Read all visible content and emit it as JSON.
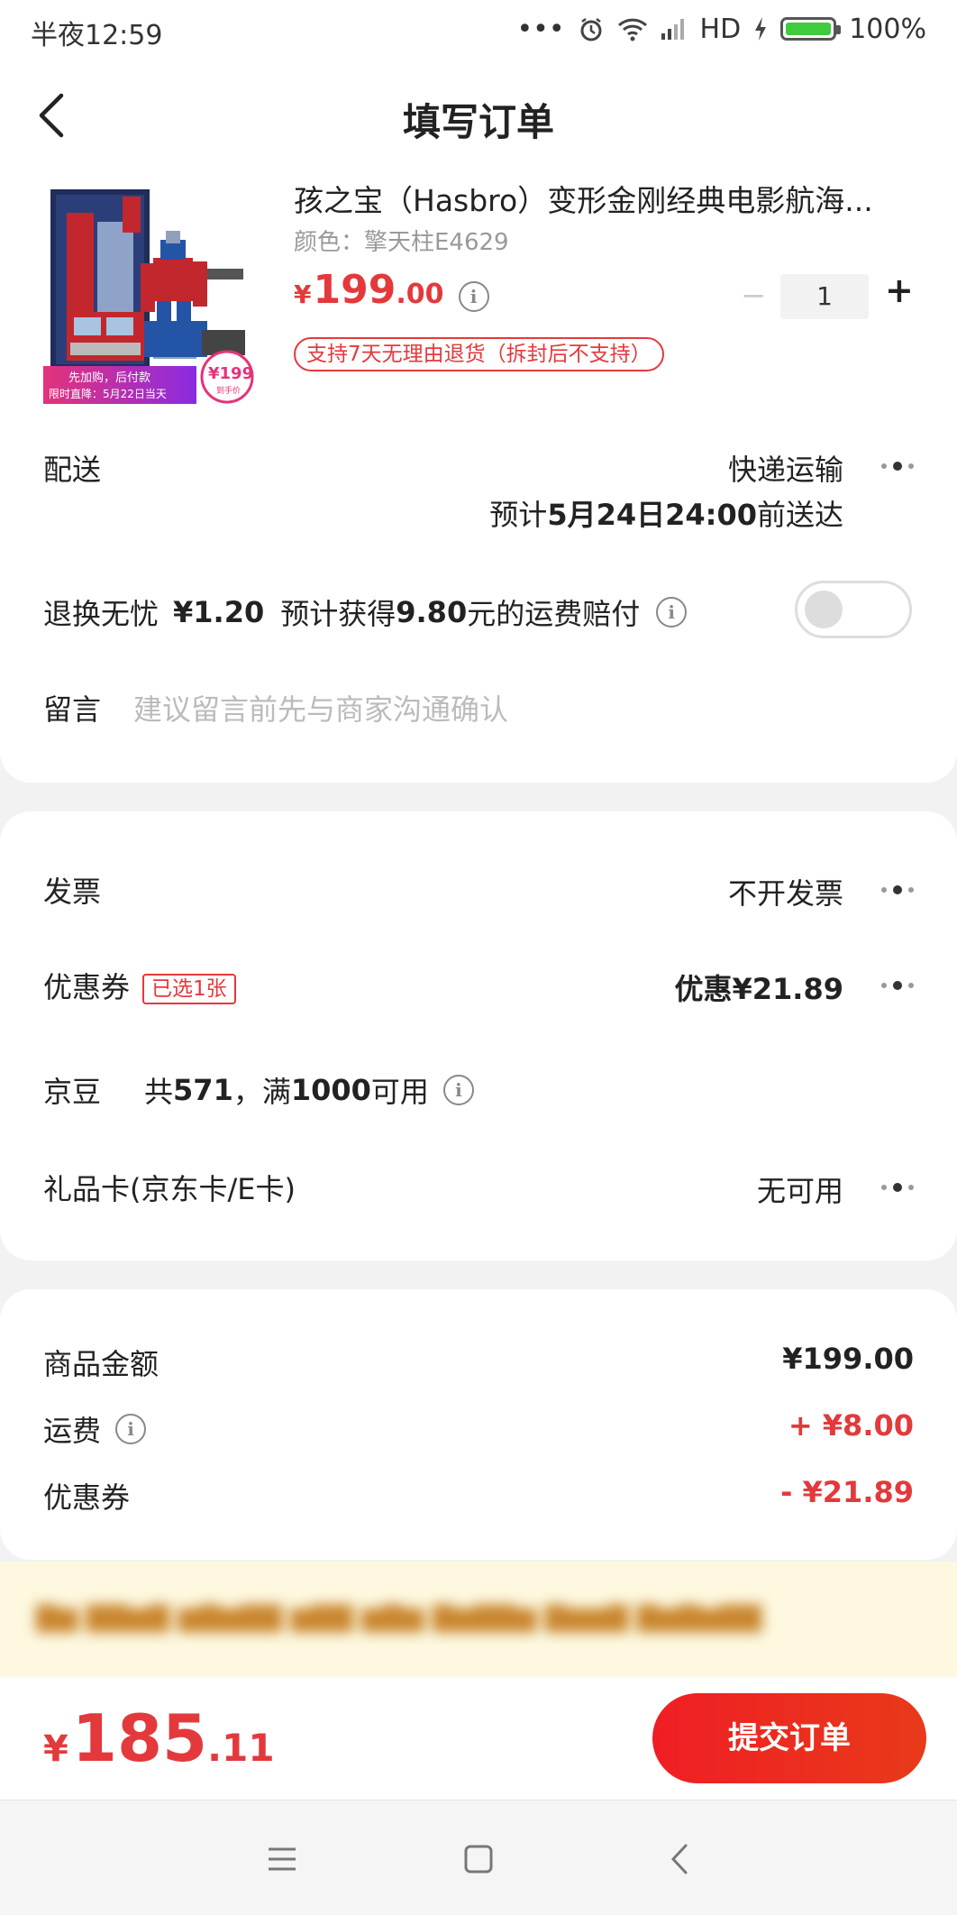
{
  "status_bar": {
    "time": "半夜12:59",
    "signal": "HD",
    "battery": "100%",
    "battery_level": 1.0
  },
  "header": {
    "title": "填写订单",
    "back_icon": "chevron-left-icon"
  },
  "product": {
    "title": "孩之宝（Hasbro）变形金刚经典电影航海...",
    "variant": "颜色：擎天柱E4629",
    "price_symbol": "¥",
    "price_int": "199",
    "price_dec": ".00",
    "quantity": "1",
    "return_tag": "支持7天无理由退货（拆封后不支持）",
    "image_banner_line1": "先加购，后付款",
    "image_banner_line2": "限时直降：5月22日当天",
    "image_price_badge": "¥199",
    "image_price_badge_note": "到手价"
  },
  "delivery": {
    "label": "配送",
    "method": "快递运输",
    "estimate_prefix": "预计",
    "estimate_date": "5月24日24:00",
    "estimate_suffix": "前送达"
  },
  "return_insurance": {
    "label": "退换无忧",
    "price": "¥1.20",
    "desc_prefix": "预计获得",
    "amount": "9.80",
    "desc_suffix": "元的运费赔付",
    "enabled": false
  },
  "message": {
    "label": "留言",
    "placeholder": "建议留言前先与商家沟通确认",
    "value": ""
  },
  "invoice": {
    "label": "发票",
    "value": "不开发票"
  },
  "coupon": {
    "label": "优惠券",
    "badge": "已选1张",
    "value": "优惠¥21.89"
  },
  "jingdou": {
    "label": "京豆",
    "prefix": "共",
    "count": "571",
    "sep": "，满",
    "threshold": "1000",
    "suffix": "可用"
  },
  "giftcard": {
    "label": "礼品卡(京东卡/E卡)",
    "value": "无可用"
  },
  "summary": {
    "goods_label": "商品金额",
    "goods_value": "¥199.00",
    "shipping_label": "运费",
    "shipping_value": "+ ¥8.00",
    "coupon_label": "优惠券",
    "coupon_value": "- ¥21.89"
  },
  "total": {
    "symbol": "¥",
    "int": "185",
    "dec": ".11"
  },
  "submit_label": "提交订单",
  "colors": {
    "accent": "#e4393c",
    "notice_bg": "#fdf8df"
  }
}
